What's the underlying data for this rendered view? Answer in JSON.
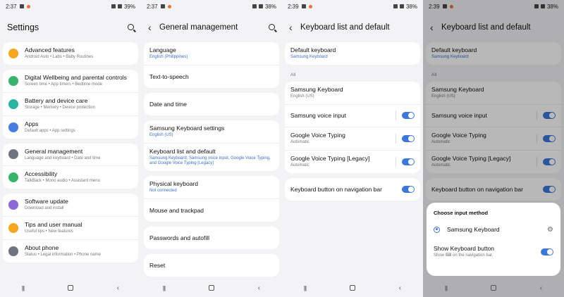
{
  "colors": {
    "accent": "#3d78d8",
    "background": "#f3f3f5",
    "card": "#ffffff"
  },
  "screen1": {
    "status": {
      "time": "2:37",
      "battery": "39%"
    },
    "title": "Settings",
    "groups": [
      [
        {
          "label": "Advanced features",
          "sub": "Android Auto  •  Labs  •  Baby Routines",
          "icon": "advanced-features-icon",
          "color": "#f5a623"
        }
      ],
      [
        {
          "label": "Digital Wellbeing and parental controls",
          "sub": "Screen time  •  App timers  •  Bedtime mode",
          "icon": "digital-wellbeing-icon",
          "color": "#38b36a"
        },
        {
          "label": "Battery and device care",
          "sub": "Storage  •  Memory  •  Device protection",
          "icon": "device-care-icon",
          "color": "#2bb5a0"
        },
        {
          "label": "Apps",
          "sub": "Default apps  •  App settings",
          "icon": "apps-icon",
          "color": "#4a7be0"
        }
      ],
      [
        {
          "label": "General management",
          "sub": "Language and keyboard  •  Date and time",
          "icon": "general-management-icon",
          "color": "#6d7580"
        },
        {
          "label": "Accessibility",
          "sub": "TalkBack  •  Mono audio  •  Assistant menu",
          "icon": "accessibility-icon",
          "color": "#38b36a"
        }
      ],
      [
        {
          "label": "Software update",
          "sub": "Download and install",
          "icon": "software-update-icon",
          "color": "#8a6ad8"
        },
        {
          "label": "Tips and user manual",
          "sub": "Useful tips  •  New features",
          "icon": "tips-icon",
          "color": "#f5a623"
        },
        {
          "label": "About phone",
          "sub": "Status  •  Legal information  •  Phone name",
          "icon": "about-phone-icon",
          "color": "#6d7580"
        }
      ]
    ]
  },
  "screen2": {
    "status": {
      "time": "2:37",
      "battery": "38%"
    },
    "title": "General management",
    "groups": [
      [
        {
          "label": "Language",
          "sub": "English (Philippines)"
        },
        {
          "label": "Text-to-speech",
          "sub": ""
        }
      ],
      [
        {
          "label": "Date and time",
          "sub": ""
        }
      ],
      [
        {
          "label": "Samsung Keyboard settings",
          "sub": "English (US)"
        },
        {
          "label": "Keyboard list and default",
          "sub": "Samsung Keyboard, Samsung voice input, Google Voice Typing, and Google Voice Typing [Legacy]"
        }
      ],
      [
        {
          "label": "Physical keyboard",
          "sub": "Not connected"
        },
        {
          "label": "Mouse and trackpad",
          "sub": ""
        }
      ],
      [
        {
          "label": "Passwords and autofill",
          "sub": ""
        }
      ],
      [
        {
          "label": "Reset",
          "sub": ""
        }
      ]
    ]
  },
  "screen3": {
    "status": {
      "time": "2:39",
      "battery": "38%"
    },
    "title": "Keyboard list and default",
    "default_label": "Default keyboard",
    "default_value": "Samsung Keyboard",
    "section_all": "All",
    "keyboards": [
      {
        "label": "Samsung Keyboard",
        "sub": "English (US)",
        "toggle": false
      },
      {
        "label": "Samsung voice input",
        "sub": "",
        "toggle": true
      },
      {
        "label": "Google Voice Typing",
        "sub": "Automatic",
        "toggle": true
      },
      {
        "label": "Google Voice Typing [Legacy]",
        "sub": "Automatic",
        "toggle": true
      }
    ],
    "navbar_button": "Keyboard button on navigation bar"
  },
  "screen4": {
    "status": {
      "time": "2:39",
      "battery": "38%"
    },
    "sheet_title": "Choose input method",
    "selected_method": "Samsung Keyboard",
    "show_button_label": "Show Keyboard button",
    "show_button_sub": "Show ⌨ on the navigation bar."
  }
}
